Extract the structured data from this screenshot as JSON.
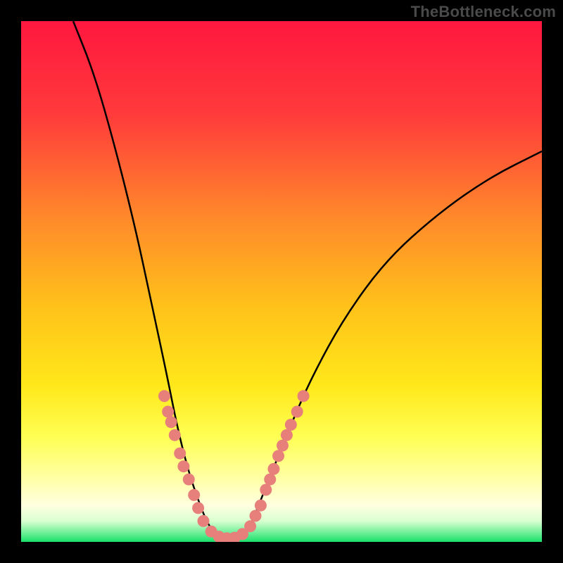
{
  "watermark": "TheBottleneck.com",
  "colors": {
    "frame": "#000000",
    "gradient_top": "#ff1a3f",
    "gradient_mid_upper": "#ff7a2a",
    "gradient_mid": "#ffd q000",
    "gradient_lower": "#ffff66",
    "gradient_pale": "#ffffd0",
    "gradient_bottom": "#19e26b",
    "curve": "#000000",
    "marker": "#e77f7b"
  },
  "chart_data": {
    "type": "line",
    "title": "",
    "xlabel": "",
    "ylabel": "",
    "xlim": [
      0,
      100
    ],
    "ylim": [
      0,
      100
    ],
    "curve": {
      "name": "bottleneck-curve",
      "points": [
        {
          "x": 10,
          "y": 100
        },
        {
          "x": 14,
          "y": 90
        },
        {
          "x": 18,
          "y": 76
        },
        {
          "x": 22,
          "y": 60
        },
        {
          "x": 25,
          "y": 46
        },
        {
          "x": 28,
          "y": 32
        },
        {
          "x": 30,
          "y": 22
        },
        {
          "x": 32,
          "y": 14
        },
        {
          "x": 34,
          "y": 8
        },
        {
          "x": 36,
          "y": 3
        },
        {
          "x": 38,
          "y": 1
        },
        {
          "x": 40,
          "y": 0.5
        },
        {
          "x": 42,
          "y": 1
        },
        {
          "x": 44,
          "y": 3
        },
        {
          "x": 46,
          "y": 8
        },
        {
          "x": 48,
          "y": 13
        },
        {
          "x": 52,
          "y": 23
        },
        {
          "x": 56,
          "y": 32
        },
        {
          "x": 62,
          "y": 43
        },
        {
          "x": 70,
          "y": 54
        },
        {
          "x": 80,
          "y": 63
        },
        {
          "x": 90,
          "y": 70
        },
        {
          "x": 100,
          "y": 75
        }
      ]
    },
    "markers": [
      {
        "x": 27.5,
        "y": 28
      },
      {
        "x": 28.2,
        "y": 25
      },
      {
        "x": 28.8,
        "y": 23
      },
      {
        "x": 29.5,
        "y": 20.5
      },
      {
        "x": 30.5,
        "y": 17
      },
      {
        "x": 31.2,
        "y": 14.5
      },
      {
        "x": 32.2,
        "y": 12
      },
      {
        "x": 33.2,
        "y": 9
      },
      {
        "x": 34.0,
        "y": 6.5
      },
      {
        "x": 35.0,
        "y": 4
      },
      {
        "x": 36.5,
        "y": 2
      },
      {
        "x": 38.0,
        "y": 1
      },
      {
        "x": 39.5,
        "y": 0.7
      },
      {
        "x": 41.0,
        "y": 0.8
      },
      {
        "x": 42.5,
        "y": 1.5
      },
      {
        "x": 44.0,
        "y": 3
      },
      {
        "x": 45.0,
        "y": 5
      },
      {
        "x": 46.0,
        "y": 7
      },
      {
        "x": 47.0,
        "y": 10
      },
      {
        "x": 47.8,
        "y": 12
      },
      {
        "x": 48.5,
        "y": 14
      },
      {
        "x": 49.4,
        "y": 16.5
      },
      {
        "x": 50.2,
        "y": 18.5
      },
      {
        "x": 51.0,
        "y": 20.5
      },
      {
        "x": 51.8,
        "y": 22.5
      },
      {
        "x": 53.0,
        "y": 25
      },
      {
        "x": 54.2,
        "y": 28
      }
    ]
  }
}
